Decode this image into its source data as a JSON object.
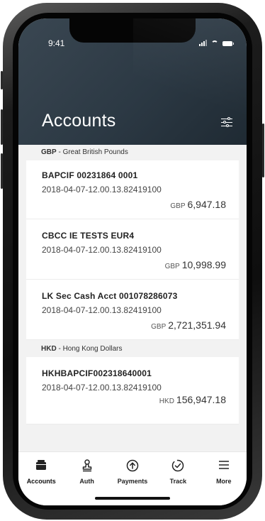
{
  "status_bar": {
    "time": "9:41"
  },
  "header": {
    "title": "Accounts",
    "filter_icon": "sliders-icon",
    "background": "#2c3944"
  },
  "groups": [
    {
      "code": "GBP",
      "separator": " - ",
      "name": "Great British Pounds",
      "accounts": [
        {
          "name": "BAPCIF 00231864 0001",
          "date": "2018-04-07-12.00.13.82419100",
          "currency": "GBP",
          "amount": "6,947.18"
        },
        {
          "name": "CBCC IE TESTS EUR4",
          "date": "2018-04-07-12.00.13.82419100",
          "currency": "GBP",
          "amount": "10,998.99"
        },
        {
          "name": "LK Sec Cash Acct 001078286073",
          "date": "2018-04-07-12.00.13.82419100",
          "currency": "GBP",
          "amount": "2,721,351.94"
        }
      ]
    },
    {
      "code": "HKD",
      "separator": " - ",
      "name": "Hong Kong Dollars",
      "accounts": [
        {
          "name": "HKHBAPCIF002318640001",
          "date": "2018-04-07-12.00.13.82419100",
          "currency": "HKD",
          "amount": "156,947.18"
        }
      ]
    }
  ],
  "tabbar": {
    "tabs": [
      {
        "label": "Accounts",
        "icon": "wallet-icon",
        "active": true
      },
      {
        "label": "Auth",
        "icon": "stamp-icon",
        "active": false
      },
      {
        "label": "Payments",
        "icon": "arrow-up-circle-icon",
        "active": false
      },
      {
        "label": "Track",
        "icon": "check-circle-icon",
        "active": false
      },
      {
        "label": "More",
        "icon": "menu-icon",
        "active": false
      }
    ]
  }
}
